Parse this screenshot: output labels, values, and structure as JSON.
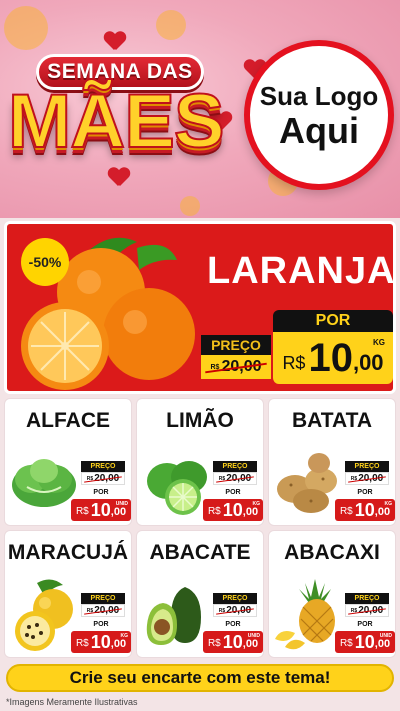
{
  "header": {
    "title_small": "SEMANA DAS",
    "title_big": "MÃES",
    "logo_line1": "Sua Logo",
    "logo_line2": "Aqui"
  },
  "featured": {
    "discount": "-50%",
    "name": "LARANJA",
    "old_label": "PREÇO",
    "old_currency": "R$",
    "old_price": "20,00",
    "new_label": "POR",
    "new_currency": "R$",
    "new_int": "10",
    "new_dec": ",00",
    "unit": "KG"
  },
  "products": [
    {
      "name": "ALFACE",
      "icon": "lettuce-icon",
      "old_label": "PREÇO",
      "old_currency": "R$",
      "old_price": "20,00",
      "new_label": "POR",
      "currency": "R$",
      "int": "10",
      "dec": ",00",
      "unit": "UNID"
    },
    {
      "name": "LIMÃO",
      "icon": "lime-icon",
      "old_label": "PREÇO",
      "old_currency": "R$",
      "old_price": "20,00",
      "new_label": "POR",
      "currency": "R$",
      "int": "10",
      "dec": ",00",
      "unit": "KG"
    },
    {
      "name": "BATATA",
      "icon": "potato-icon",
      "old_label": "PREÇO",
      "old_currency": "R$",
      "old_price": "20,00",
      "new_label": "POR",
      "currency": "R$",
      "int": "10",
      "dec": ",00",
      "unit": "KG"
    },
    {
      "name": "MARACUJÁ",
      "icon": "passion-fruit-icon",
      "old_label": "PREÇO",
      "old_currency": "R$",
      "old_price": "20,00",
      "new_label": "POR",
      "currency": "R$",
      "int": "10",
      "dec": ",00",
      "unit": "KG"
    },
    {
      "name": "ABACATE",
      "icon": "avocado-icon",
      "old_label": "PREÇO",
      "old_currency": "R$",
      "old_price": "20,00",
      "new_label": "POR",
      "currency": "R$",
      "int": "10",
      "dec": ",00",
      "unit": "UNID"
    },
    {
      "name": "ABACAXI",
      "icon": "pineapple-icon",
      "old_label": "PREÇO",
      "old_currency": "R$",
      "old_price": "20,00",
      "new_label": "POR",
      "currency": "R$",
      "int": "10",
      "dec": ",00",
      "unit": "UNID"
    }
  ],
  "footer": {
    "cta": "Crie seu encarte com este tema!",
    "disclaimer": "*Imagens Meramente Ilustrativas"
  },
  "colors": {
    "primary_red": "#db1a1a",
    "accent_yellow": "#ffd21a",
    "header_pink": "#f0a8bb"
  }
}
